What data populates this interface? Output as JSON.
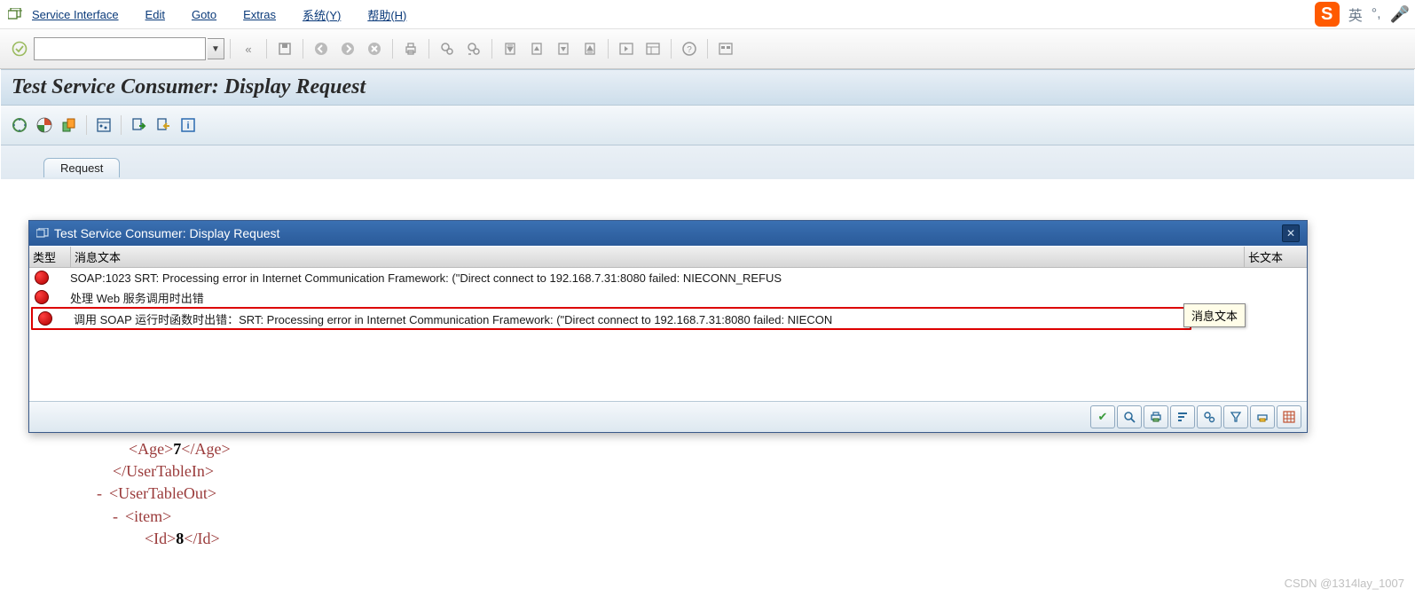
{
  "menu": {
    "items": [
      "Service Interface",
      "Edit",
      "Goto",
      "Extras",
      "系统(Y)",
      "帮助(H)"
    ]
  },
  "page": {
    "title": "Test Service Consumer: Display Request"
  },
  "tabs": {
    "request": "Request"
  },
  "dialog": {
    "title": "Test Service Consumer: Display Request",
    "columns": {
      "type": "类型",
      "msg": "消息文本",
      "long": "长文本"
    },
    "tooltip": "消息文本",
    "rows": [
      {
        "type": "error",
        "text": "SOAP:1023 SRT: Processing error in Internet Communication Framework: (\"Direct connect to 192.168.7.31:8080 failed: NIECONN_REFUS"
      },
      {
        "type": "error",
        "text": "处理 Web 服务调用时出错"
      },
      {
        "type": "error",
        "text": "调用 SOAP 运行时函数时出错：SRT: Processing error in Internet Communication Framework: (\"Direct connect to 192.168.7.31:8080 failed: NIECON",
        "highlight": true
      }
    ]
  },
  "xml": {
    "age_open": "<Age>",
    "age_val": "7",
    "age_close": "</Age>",
    "uti_close": "</UserTableIn>",
    "uto_open": "<UserTableOut>",
    "item_open": "<item>",
    "id_open": "<Id>",
    "id_val": "8",
    "id_close": "</Id>"
  },
  "watermark": "CSDN @1314lay_1007",
  "ime": {
    "lang": "英",
    "mic": "🎤"
  }
}
